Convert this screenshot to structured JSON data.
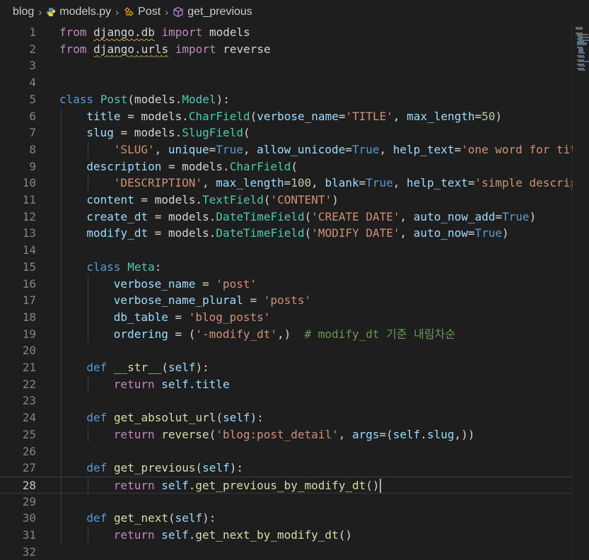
{
  "breadcrumb": {
    "folder": "blog",
    "file": "models.py",
    "class": "Post",
    "method": "get_previous"
  },
  "editor": {
    "current_line": 28,
    "lines": [
      {
        "n": "1",
        "indent": 0,
        "tokens": [
          [
            "kw2",
            "from"
          ],
          [
            "",
            "",
            " "
          ],
          [
            "squig",
            "django.db"
          ],
          [
            "",
            "",
            " "
          ],
          [
            "kw2",
            "import"
          ],
          [
            "",
            " models"
          ]
        ]
      },
      {
        "n": "2",
        "indent": 0,
        "tokens": [
          [
            "kw2",
            "from"
          ],
          [
            "",
            " "
          ],
          [
            "squig",
            "django.urls"
          ],
          [
            "",
            " "
          ],
          [
            "kw2",
            "import"
          ],
          [
            "",
            " reverse"
          ]
        ]
      },
      {
        "n": "3",
        "indent": 0,
        "tokens": []
      },
      {
        "n": "4",
        "indent": 0,
        "tokens": []
      },
      {
        "n": "5",
        "indent": 0,
        "tokens": [
          [
            "kw",
            "class"
          ],
          [
            "",
            " "
          ],
          [
            "cls",
            "Post"
          ],
          [
            "",
            "(models."
          ],
          [
            "cls",
            "Model"
          ],
          [
            "",
            "):"
          ]
        ]
      },
      {
        "n": "6",
        "indent": 1,
        "tokens": [
          [
            "var",
            "title"
          ],
          [
            "",
            " = models."
          ],
          [
            "cls",
            "CharField"
          ],
          [
            "",
            "("
          ],
          [
            "var",
            "verbose_name"
          ],
          [
            "",
            "="
          ],
          [
            "str",
            "'TITLE'"
          ],
          [
            "",
            ", "
          ],
          [
            "var",
            "max_length"
          ],
          [
            "",
            "="
          ],
          [
            "num",
            "50"
          ],
          [
            "",
            ")"
          ]
        ]
      },
      {
        "n": "7",
        "indent": 1,
        "tokens": [
          [
            "var",
            "slug"
          ],
          [
            "",
            " = models."
          ],
          [
            "cls",
            "SlugField"
          ],
          [
            "",
            "("
          ]
        ]
      },
      {
        "n": "8",
        "indent": 2,
        "tokens": [
          [
            "str",
            "'SLUG'"
          ],
          [
            "",
            ", "
          ],
          [
            "var",
            "unique"
          ],
          [
            "",
            "="
          ],
          [
            "kw",
            "True"
          ],
          [
            "",
            ", "
          ],
          [
            "var",
            "allow_unicode"
          ],
          [
            "",
            "="
          ],
          [
            "kw",
            "True"
          ],
          [
            "",
            ", "
          ],
          [
            "var",
            "help_text"
          ],
          [
            "",
            "="
          ],
          [
            "str",
            "'one word for title alias.'"
          ],
          [
            "",
            ")"
          ]
        ]
      },
      {
        "n": "9",
        "indent": 1,
        "tokens": [
          [
            "var",
            "description"
          ],
          [
            "",
            " = models."
          ],
          [
            "cls",
            "CharField"
          ],
          [
            "",
            "("
          ]
        ]
      },
      {
        "n": "10",
        "indent": 2,
        "tokens": [
          [
            "str",
            "'DESCRIPTION'"
          ],
          [
            "",
            ", "
          ],
          [
            "var",
            "max_length"
          ],
          [
            "",
            "="
          ],
          [
            "num",
            "100"
          ],
          [
            "",
            ", "
          ],
          [
            "var",
            "blank"
          ],
          [
            "",
            "="
          ],
          [
            "kw",
            "True"
          ],
          [
            "",
            ", "
          ],
          [
            "var",
            "help_text"
          ],
          [
            "",
            "="
          ],
          [
            "str",
            "'simple description text.'"
          ],
          [
            "",
            ")"
          ]
        ]
      },
      {
        "n": "11",
        "indent": 1,
        "tokens": [
          [
            "var",
            "content"
          ],
          [
            "",
            " = models."
          ],
          [
            "cls",
            "TextField"
          ],
          [
            "",
            "("
          ],
          [
            "str",
            "'CONTENT'"
          ],
          [
            "",
            ")"
          ]
        ]
      },
      {
        "n": "12",
        "indent": 1,
        "tokens": [
          [
            "var",
            "create_dt"
          ],
          [
            "",
            " = models."
          ],
          [
            "cls",
            "DateTimeField"
          ],
          [
            "",
            "("
          ],
          [
            "str",
            "'CREATE DATE'"
          ],
          [
            "",
            ", "
          ],
          [
            "var",
            "auto_now_add"
          ],
          [
            "",
            "="
          ],
          [
            "kw",
            "True"
          ],
          [
            "",
            ")"
          ]
        ]
      },
      {
        "n": "13",
        "indent": 1,
        "tokens": [
          [
            "var",
            "modify_dt"
          ],
          [
            "",
            " = models."
          ],
          [
            "cls",
            "DateTimeField"
          ],
          [
            "",
            "("
          ],
          [
            "str",
            "'MODIFY DATE'"
          ],
          [
            "",
            ", "
          ],
          [
            "var",
            "auto_now"
          ],
          [
            "",
            "="
          ],
          [
            "kw",
            "True"
          ],
          [
            "",
            ")"
          ]
        ]
      },
      {
        "n": "14",
        "indent": 1,
        "tokens": []
      },
      {
        "n": "15",
        "indent": 1,
        "tokens": [
          [
            "kw",
            "class"
          ],
          [
            "",
            " "
          ],
          [
            "cls",
            "Meta"
          ],
          [
            "",
            ":"
          ]
        ]
      },
      {
        "n": "16",
        "indent": 2,
        "tokens": [
          [
            "var",
            "verbose_name"
          ],
          [
            "",
            " = "
          ],
          [
            "str",
            "'post'"
          ]
        ]
      },
      {
        "n": "17",
        "indent": 2,
        "tokens": [
          [
            "var",
            "verbose_name_plural"
          ],
          [
            "",
            " = "
          ],
          [
            "str",
            "'posts'"
          ]
        ]
      },
      {
        "n": "18",
        "indent": 2,
        "tokens": [
          [
            "var",
            "db_table"
          ],
          [
            "",
            " = "
          ],
          [
            "str",
            "'blog_posts'"
          ]
        ]
      },
      {
        "n": "19",
        "indent": 2,
        "tokens": [
          [
            "var",
            "ordering"
          ],
          [
            "",
            " = ("
          ],
          [
            "str",
            "'-modify_dt'"
          ],
          [
            "",
            ",)  "
          ],
          [
            "cmt",
            "# modify_dt 기준 내림차순"
          ]
        ]
      },
      {
        "n": "20",
        "indent": 1,
        "tokens": []
      },
      {
        "n": "21",
        "indent": 1,
        "tokens": [
          [
            "kw",
            "def"
          ],
          [
            "",
            " "
          ],
          [
            "fn",
            "__str__"
          ],
          [
            "",
            "("
          ],
          [
            "var",
            "self"
          ],
          [
            "",
            "):"
          ]
        ]
      },
      {
        "n": "22",
        "indent": 2,
        "tokens": [
          [
            "kw2",
            "return"
          ],
          [
            "",
            " "
          ],
          [
            "var",
            "self"
          ],
          [
            "",
            "."
          ],
          [
            "var",
            "title"
          ]
        ]
      },
      {
        "n": "23",
        "indent": 1,
        "tokens": []
      },
      {
        "n": "24",
        "indent": 1,
        "tokens": [
          [
            "kw",
            "def"
          ],
          [
            "",
            " "
          ],
          [
            "fn",
            "get_absolut_url"
          ],
          [
            "",
            "("
          ],
          [
            "var",
            "self"
          ],
          [
            "",
            "):"
          ]
        ]
      },
      {
        "n": "25",
        "indent": 2,
        "tokens": [
          [
            "kw2",
            "return"
          ],
          [
            "",
            " "
          ],
          [
            "fn",
            "reverse"
          ],
          [
            "",
            "("
          ],
          [
            "str",
            "'blog:post_detail'"
          ],
          [
            "",
            ", "
          ],
          [
            "var",
            "args"
          ],
          [
            "",
            "=("
          ],
          [
            "var",
            "self"
          ],
          [
            "",
            "."
          ],
          [
            "var",
            "slug"
          ],
          [
            "",
            ",))"
          ]
        ]
      },
      {
        "n": "26",
        "indent": 1,
        "tokens": []
      },
      {
        "n": "27",
        "indent": 1,
        "tokens": [
          [
            "kw",
            "def"
          ],
          [
            "",
            " "
          ],
          [
            "fn",
            "get_previous"
          ],
          [
            "",
            "("
          ],
          [
            "var",
            "self"
          ],
          [
            "",
            "):"
          ]
        ]
      },
      {
        "n": "28",
        "indent": 2,
        "tokens": [
          [
            "kw2",
            "return"
          ],
          [
            "",
            " "
          ],
          [
            "var",
            "self"
          ],
          [
            "",
            "."
          ],
          [
            "fn",
            "get_previous_by_modify_dt"
          ],
          [
            "",
            "()"
          ]
        ]
      },
      {
        "n": "29",
        "indent": 1,
        "tokens": []
      },
      {
        "n": "30",
        "indent": 1,
        "tokens": [
          [
            "kw",
            "def"
          ],
          [
            "",
            " "
          ],
          [
            "fn",
            "get_next"
          ],
          [
            "",
            "("
          ],
          [
            "var",
            "self"
          ],
          [
            "",
            "):"
          ]
        ]
      },
      {
        "n": "31",
        "indent": 2,
        "tokens": [
          [
            "kw2",
            "return"
          ],
          [
            "",
            " "
          ],
          [
            "var",
            "self"
          ],
          [
            "",
            "."
          ],
          [
            "fn",
            "get_next_by_modify_dt"
          ],
          [
            "",
            "()"
          ]
        ]
      },
      {
        "n": "32",
        "indent": 0,
        "tokens": []
      }
    ]
  },
  "icons": {
    "python_file": "python-icon",
    "class_symbol": "class-symbol-icon",
    "method_symbol": "method-cube-icon",
    "separator": "chevron-right-icon"
  },
  "colors": {
    "background": "#1e1e1e",
    "keyword": "#569cd6",
    "control_keyword": "#c586c0",
    "class_name": "#4ec9b0",
    "string": "#ce9178",
    "number": "#b5cea8",
    "variable": "#9cdcfe",
    "function": "#dcdcaa",
    "comment": "#6a9955"
  }
}
